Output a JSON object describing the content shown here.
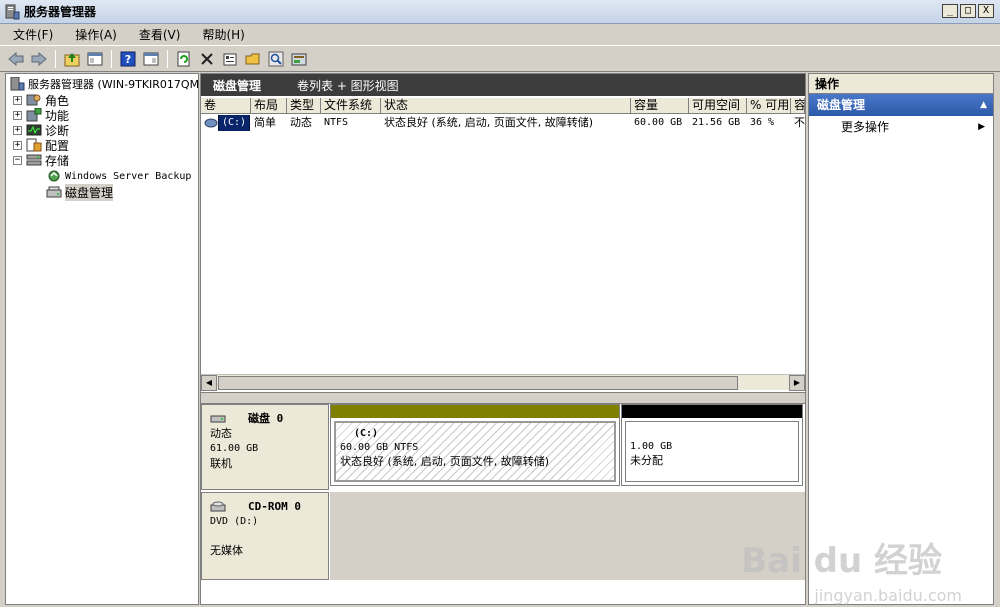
{
  "window": {
    "title": "服务器管理器",
    "buttons": [
      "_",
      "□",
      "X"
    ]
  },
  "menu": [
    {
      "label": "文件(F)"
    },
    {
      "label": "操作(A)"
    },
    {
      "label": "查看(V)"
    },
    {
      "label": "帮助(H)"
    }
  ],
  "toolbar": {
    "icons": [
      "back-icon",
      "forward-icon",
      "up-icon",
      "show-hide-tree-icon",
      "help-icon",
      "show-hide-action-icon",
      "refresh-icon",
      "delete-icon",
      "properties-icon",
      "open-icon",
      "search-icon",
      "export-icon"
    ]
  },
  "tree": {
    "root": "服务器管理器 (WIN-9TKIR017QM",
    "items": [
      {
        "label": "角色",
        "expander": "+"
      },
      {
        "label": "功能",
        "expander": "+"
      },
      {
        "label": "诊断",
        "expander": "+"
      },
      {
        "label": "配置",
        "expander": "+"
      },
      {
        "label": "存储",
        "expander": "−"
      }
    ],
    "storage_children": [
      {
        "label": "Windows Server Backup"
      },
      {
        "label": "磁盘管理"
      }
    ]
  },
  "center": {
    "title": "磁盘管理",
    "subtitle": "卷列表 + 图形视图",
    "columns": [
      "卷",
      "布局",
      "类型",
      "文件系统",
      "状态",
      "容量",
      "可用空间",
      "% 可用",
      "容"
    ],
    "rows": [
      {
        "volume": "(C:)",
        "layout": "简单",
        "type": "动态",
        "fs": "NTFS",
        "status": "状态良好 (系统, 启动, 页面文件, 故障转储)",
        "capacity": "60.00 GB",
        "free": "21.56 GB",
        "pct": "36 %",
        "extra": "不"
      }
    ]
  },
  "disks": [
    {
      "name": "磁盘 0",
      "type": "动态",
      "size": "61.00 GB",
      "status": "联机",
      "partitions": [
        {
          "label": "(C:)",
          "size_fs": "60.00 GB NTFS",
          "status": "状态良好 (系统, 启动, 页面文件, 故障转储)",
          "bar_color": "#808000"
        },
        {
          "label": "",
          "size_fs": "1.00 GB",
          "status": "未分配",
          "bar_color": "#000000"
        }
      ]
    },
    {
      "name": "CD-ROM 0",
      "type": "DVD (D:)",
      "status": "无媒体"
    }
  ],
  "actions": {
    "header": "操作",
    "section": "磁盘管理",
    "items": [
      {
        "label": "更多操作"
      }
    ]
  },
  "watermark": {
    "text": "Bai du 经验",
    "sub": "jingyan.baidu.com"
  }
}
